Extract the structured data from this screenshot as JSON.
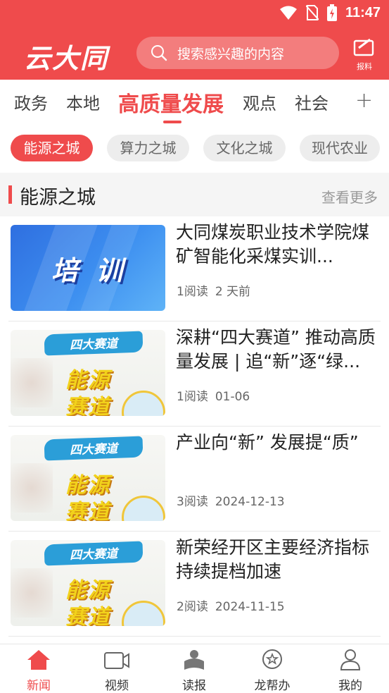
{
  "status_bar": {
    "time": "11:47"
  },
  "header": {
    "logo": "云大同",
    "search_placeholder": "搜索感兴趣的内容",
    "report_label": "报料"
  },
  "channels": [
    "政务",
    "本地",
    "高质量发展",
    "观点",
    "社会"
  ],
  "active_channel": "高质量发展",
  "sub_channels": [
    "能源之城",
    "算力之城",
    "文化之城",
    "现代农业"
  ],
  "section": {
    "title": "能源之城",
    "more": "查看更多"
  },
  "news": [
    {
      "title": "大同煤炭职业技术学院煤矿智能化采煤实训...",
      "reads": "1阅读",
      "time": "2 天前",
      "thumb_text": "培 训"
    },
    {
      "title": "深耕“四大赛道” 推动高质量发展 | 追“新”逐“绿...",
      "reads": "1阅读",
      "time": "01-06",
      "banner": "四大赛道",
      "big1": "能源",
      "big2": "赛道"
    },
    {
      "title": "产业向“新” 发展提“质”",
      "reads": "3阅读",
      "time": "2024-12-13",
      "banner": "四大赛道",
      "big1": "能源",
      "big2": "赛道"
    },
    {
      "title": "新荣经开区主要经济指标持续提档加速",
      "reads": "2阅读",
      "time": "2024-11-15",
      "banner": "四大赛道",
      "big1": "能源",
      "big2": "赛道"
    }
  ],
  "bottom_nav": [
    "新闻",
    "视频",
    "读报",
    "龙帮办",
    "我的"
  ],
  "colors": {
    "brand": "#EF4B4C"
  }
}
